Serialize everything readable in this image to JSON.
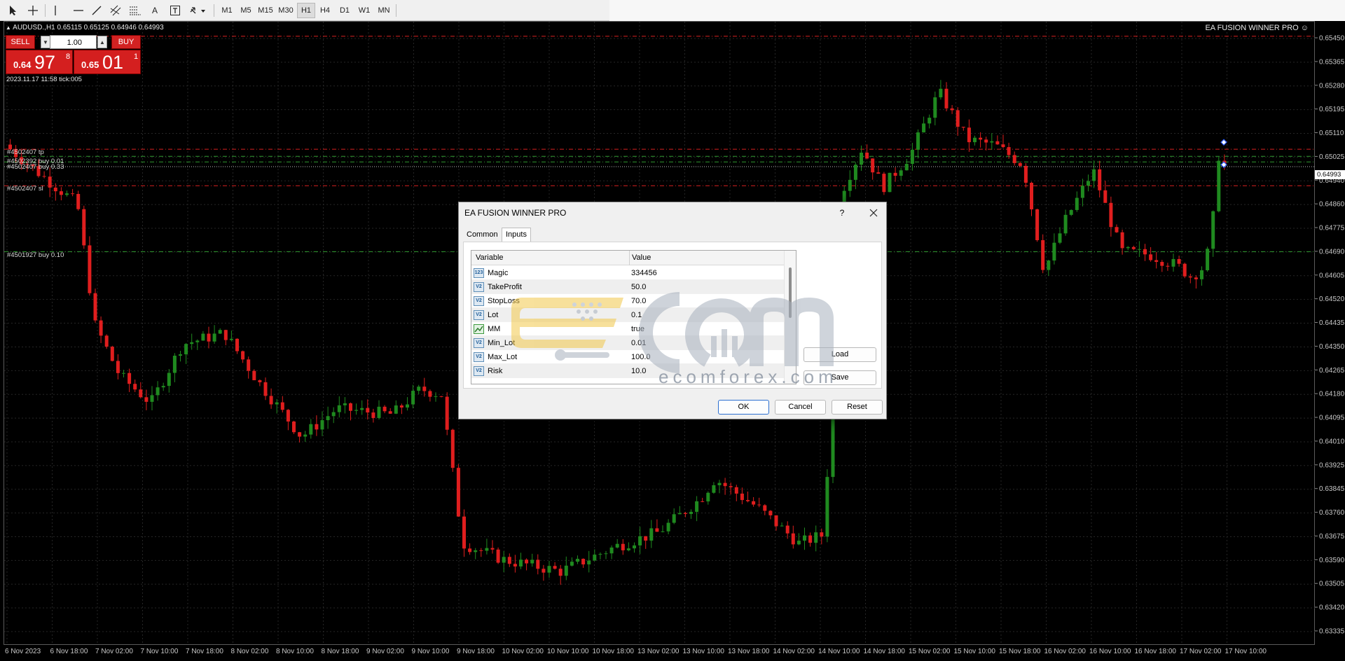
{
  "toolbar": {
    "timeframes": [
      "M1",
      "M5",
      "M15",
      "M30",
      "H1",
      "H4",
      "D1",
      "W1",
      "MN"
    ],
    "active_timeframe": "H1"
  },
  "chart": {
    "symbol_line": "AUDUSD.,H1  0.65115 0.65125 0.64946 0.64993",
    "ea_name": "EA FUSION WINNER PRO ☺",
    "tick_info": "2023.11.17 11:58 tick:005",
    "current_price": "0.64993",
    "price_ticks": [
      "0.65450",
      "0.65365",
      "0.65280",
      "0.65195",
      "0.65110",
      "0.65025",
      "0.64940",
      "0.64860",
      "0.64775",
      "0.64690",
      "0.64605",
      "0.64520",
      "0.64435",
      "0.64350",
      "0.64265",
      "0.64180",
      "0.64095",
      "0.64010",
      "0.63925",
      "0.63845",
      "0.63760",
      "0.63675",
      "0.63590",
      "0.63505",
      "0.63420",
      "0.63335"
    ],
    "time_ticks": [
      "6 Nov 2023",
      "6 Nov 18:00",
      "7 Nov 02:00",
      "7 Nov 10:00",
      "7 Nov 18:00",
      "8 Nov 02:00",
      "8 Nov 10:00",
      "8 Nov 18:00",
      "9 Nov 02:00",
      "9 Nov 10:00",
      "9 Nov 18:00",
      "10 Nov 02:00",
      "10 Nov 10:00",
      "10 Nov 18:00",
      "13 Nov 02:00",
      "13 Nov 10:00",
      "13 Nov 18:00",
      "14 Nov 02:00",
      "14 Nov 10:00",
      "14 Nov 18:00",
      "15 Nov 02:00",
      "15 Nov 10:00",
      "15 Nov 18:00",
      "16 Nov 02:00",
      "16 Nov 10:00",
      "16 Nov 18:00",
      "17 Nov 02:00",
      "17 Nov 10:00"
    ],
    "order_labels": {
      "tp": "#4502407 tp",
      "buy1": "#4502392 buy 0.01",
      "buy2": "#4502407 buy 0.33",
      "sl": "#4502407 sl",
      "buy3": "#4501927 buy 0.10"
    }
  },
  "one_click": {
    "sell_label": "SELL",
    "buy_label": "BUY",
    "lot": "1.00",
    "bid_small": "0.64",
    "bid_big": "97",
    "bid_sup": "8",
    "ask_small": "0.65",
    "ask_big": "01",
    "ask_sup": "1"
  },
  "dialog": {
    "title": "EA FUSION WINNER PRO",
    "help": "?",
    "tabs": [
      "Common",
      "Inputs"
    ],
    "active_tab": "Inputs",
    "columns": [
      "Variable",
      "Value"
    ],
    "rows": [
      {
        "icon": "123",
        "name": "Magic",
        "value": "334456"
      },
      {
        "icon": "V2",
        "name": "TakeProfit",
        "value": "50.0"
      },
      {
        "icon": "V2",
        "name": "StopLoss",
        "value": "70.0"
      },
      {
        "icon": "V2",
        "name": "Lot",
        "value": "0.1"
      },
      {
        "icon": "mm",
        "name": "MM",
        "value": "true"
      },
      {
        "icon": "V2",
        "name": "Min_Lot",
        "value": "0.01"
      },
      {
        "icon": "V2",
        "name": "Max_Lot",
        "value": "100.0"
      },
      {
        "icon": "V2",
        "name": "Risk",
        "value": "10.0"
      }
    ],
    "load_label": "Load",
    "save_label": "Save",
    "ok_label": "OK",
    "cancel_label": "Cancel",
    "reset_label": "Reset"
  },
  "watermark": {
    "brand": "ecomforex.com"
  },
  "colors": {
    "bull": "#1f8a1f",
    "bear": "#e01e1e",
    "grid": "#262626",
    "tp_line": "#d92020",
    "buy_line": "#2f9a2f"
  }
}
